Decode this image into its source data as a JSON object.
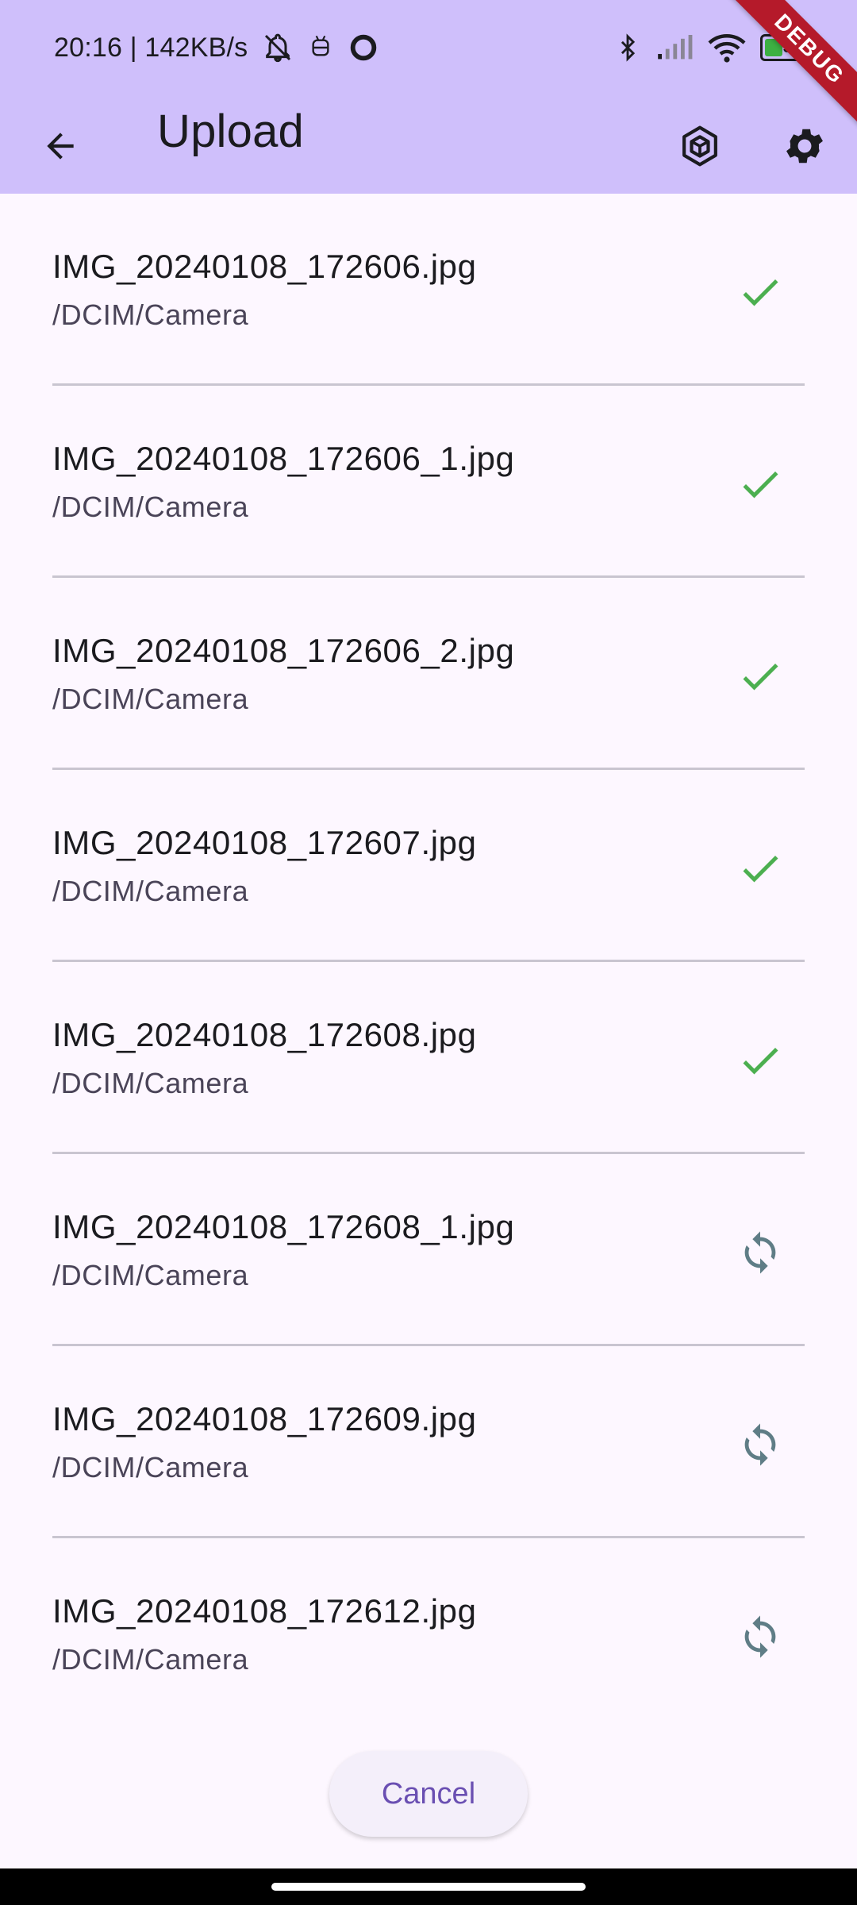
{
  "status_bar": {
    "time_speed": "20:16 | 142KB/s",
    "battery_level": "35",
    "icons": [
      "bell-off-icon",
      "android-debug-icon",
      "circle-icon",
      "bluetooth-icon",
      "cell-signal-icon",
      "wifi-icon",
      "battery-icon"
    ]
  },
  "app_bar": {
    "title": "Upload",
    "actions": [
      "cube-icon",
      "gear-icon"
    ],
    "debug_banner": "DEBUG"
  },
  "files": [
    {
      "name": "IMG_20240108_172606.jpg",
      "path": "/DCIM/Camera",
      "status": "done"
    },
    {
      "name": "IMG_20240108_172606_1.jpg",
      "path": "/DCIM/Camera",
      "status": "done"
    },
    {
      "name": "IMG_20240108_172606_2.jpg",
      "path": "/DCIM/Camera",
      "status": "done"
    },
    {
      "name": "IMG_20240108_172607.jpg",
      "path": "/DCIM/Camera",
      "status": "done"
    },
    {
      "name": "IMG_20240108_172608.jpg",
      "path": "/DCIM/Camera",
      "status": "done"
    },
    {
      "name": "IMG_20240108_172608_1.jpg",
      "path": "/DCIM/Camera",
      "status": "pending"
    },
    {
      "name": "IMG_20240108_172609.jpg",
      "path": "/DCIM/Camera",
      "status": "pending"
    },
    {
      "name": "IMG_20240108_172612.jpg",
      "path": "/DCIM/Camera",
      "status": "pending"
    }
  ],
  "actions": {
    "cancel_label": "Cancel"
  },
  "colors": {
    "header_bg": "#cfbffb",
    "page_bg": "#fdf7ff",
    "done_green": "#4caf50",
    "pending_gray": "#5f7d86",
    "accent_purple": "#6a4fb2"
  }
}
